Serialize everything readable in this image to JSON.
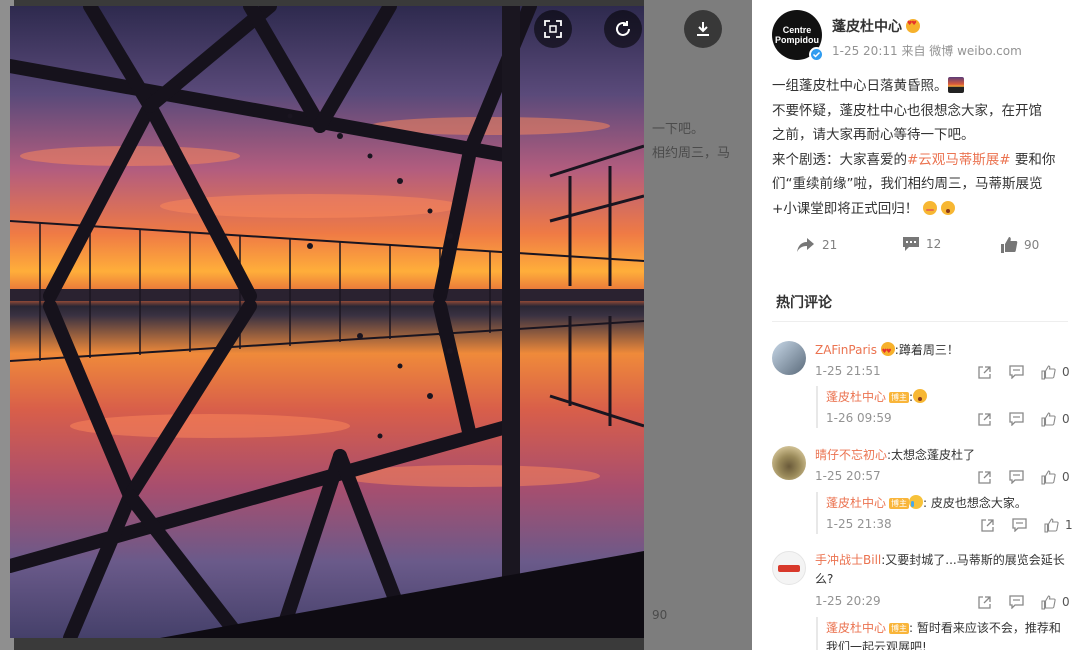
{
  "post": {
    "author_name": "蓬皮杜中心",
    "avatar_text": "Centre Pompidou",
    "meta": "1-25 20:11 来自 微博 weibo.com",
    "text_lines": [
      "一组蓬皮杜中心日落黄昏照。",
      "不要怀疑，蓬皮杜中心也很想念大家，在开馆",
      "之前，请大家再耐心等待一下吧。"
    ],
    "line4_prefix": "来个剧透：大家喜爱的",
    "hashtag": "#云观马蒂斯展#",
    "line4_suffix": "要和你",
    "line5": "们“重续前缘”啦，我们相约周三，马蒂斯展览",
    "line6": "+小课堂即将正式回归！"
  },
  "actions": {
    "repost_count": "21",
    "comment_count": "12",
    "like_count": "90"
  },
  "comments_title": "热门评论",
  "comments": [
    {
      "user": "ZAFinParis",
      "text": ":蹲着周三！",
      "time": "1-25 21:51",
      "likes": "0",
      "reply": {
        "user": "蓬皮杜中心",
        "badge": "博主",
        "text": ":",
        "time": "1-26 09:59",
        "likes": "0"
      }
    },
    {
      "user": "晴仔不忘初心",
      "text": ":太想念蓬皮杜了",
      "time": "1-25 20:57",
      "likes": "0",
      "reply": {
        "user": "蓬皮杜中心",
        "badge": "博主",
        "text": ": 皮皮也想念大家。",
        "time": "1-25 21:38",
        "likes": "1"
      }
    },
    {
      "user": "手冲战士Bill",
      "text": ":又要封城了...马蒂斯的展览会延长",
      "text2": "么?",
      "time": "1-25 20:29",
      "likes": "0",
      "reply": {
        "user": "蓬皮杜中心",
        "badge": "博主",
        "text": ": 暂时看来应该不会，推荐和",
        "text2": "我们一起云观展吧!"
      }
    }
  ],
  "bg_text": {
    "snippet1": "一下吧。",
    "snippet2": "相约周三，马",
    "count": "90"
  },
  "colors": {
    "link": "#eb7350",
    "verified": "#2f9cf0"
  }
}
